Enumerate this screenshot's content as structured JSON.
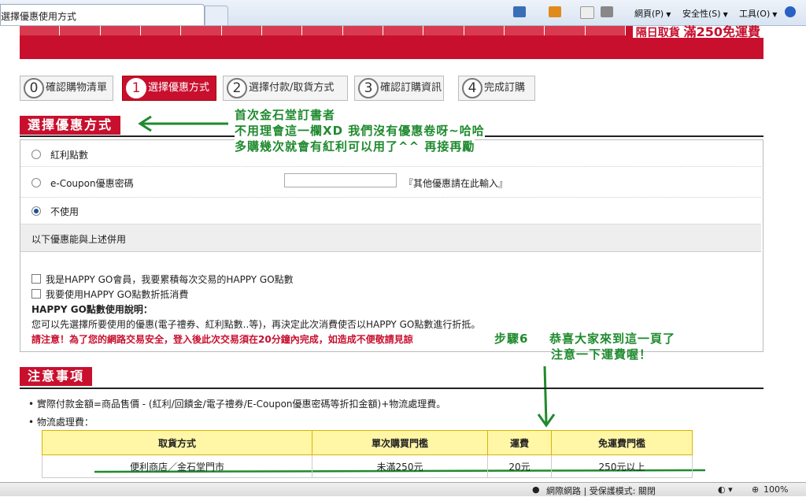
{
  "browser": {
    "tab_title": "選擇優惠使用方式",
    "menu": {
      "page": "網頁(P)",
      "safety": "安全性(S)",
      "tools": "工具(O)"
    }
  },
  "site": {
    "promo_prefix": "隔日取貨",
    "promo_amount": "滿250免運費"
  },
  "steps": [
    {
      "num": "0",
      "label": "確認購物清單"
    },
    {
      "num": "1",
      "label": "選擇優惠方式"
    },
    {
      "num": "2",
      "label": "選擇付款/取貨方式"
    },
    {
      "num": "3",
      "label": "確認訂購資訊"
    },
    {
      "num": "4",
      "label": "完成訂購"
    }
  ],
  "discount": {
    "title": "選擇優惠方式",
    "options": {
      "bonus": "紅利點數",
      "ecoupon": "e-Coupon優惠密碼",
      "none": "不使用"
    },
    "other_hint": "『其他優惠請在此輸入』",
    "combine_label": "以下優惠能與上述併用",
    "happygo_accumulate": "我是HAPPY GO會員，我要累積每次交易的HAPPY GO點數",
    "happygo_redeem": "我要使用HAPPY GO點數折抵消費",
    "happygo_title": "HAPPY GO點數使用說明：",
    "happygo_desc": "您可以先選擇所要使用的優惠(電子禮券、紅利點數..等)，再決定此次消費使否以HAPPY GO點數進行折抵。",
    "warning": "請注意！為了您的網路交易安全，登入後此次交易須在20分鐘內完成，如造成不便敬請見諒"
  },
  "annotations": {
    "line1": "首次金石堂訂書者",
    "line2": "不用理會這一欄XD 我們沒有優惠卷呀~哈哈",
    "line3": "多購幾次就會有紅利可以用了^^ 再接再勵",
    "step_label": "步驟6",
    "congrats1": "恭喜大家來到這一頁了",
    "congrats2": "注意一下運費喔！"
  },
  "notice": {
    "title": "注意事項",
    "bullet1": "實際付款金額=商品售價 - (紅利/回饋金/電子禮券/E-Coupon優惠密碼等折扣金額)+物流處理費。",
    "bullet2": "物流處理費：",
    "table": {
      "headers": [
        "取貨方式",
        "單次購買門檻",
        "運費",
        "免運費門檻"
      ],
      "rows": [
        [
          "便利商店／金石堂門市",
          "未滿250元",
          "20元",
          "250元以上"
        ]
      ]
    }
  },
  "status": {
    "zone": "網際網路 | 受保護模式: 關閉",
    "zoom": "100%"
  },
  "colors": {
    "brand_red": "#c8102e",
    "annotation_green": "#1f8a2e",
    "table_header": "#fff6a6"
  }
}
